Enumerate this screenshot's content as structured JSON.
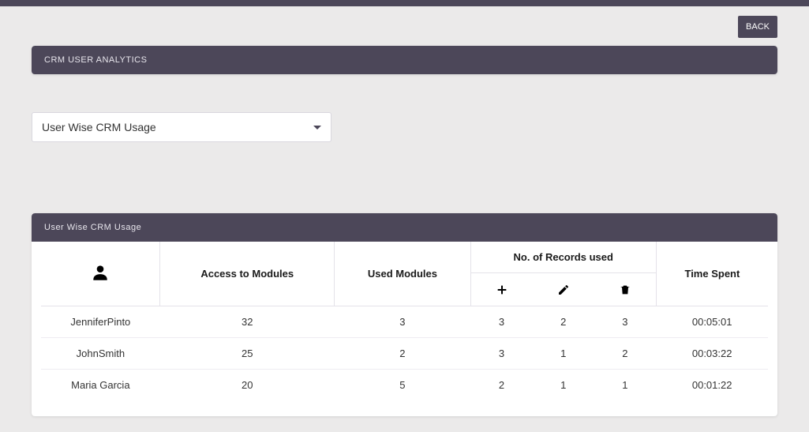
{
  "buttons": {
    "back": "BACK"
  },
  "header": {
    "title": "CRM USER ANALYTICS"
  },
  "dropdown": {
    "selected": "User Wise CRM Usage"
  },
  "table_panel": {
    "title": "User Wise CRM Usage"
  },
  "columns": {
    "access": "Access to Modules",
    "used": "Used Modules",
    "records_group": "No. of Records used",
    "time": "Time Spent"
  },
  "record_icons": {
    "add": "plus-icon",
    "edit": "pencil-icon",
    "delete": "trash-icon"
  },
  "rows": [
    {
      "name": "JenniferPinto",
      "access": "32",
      "used": "3",
      "added": "3",
      "edited": "2",
      "deleted": "3",
      "time": "00:05:01"
    },
    {
      "name": "JohnSmith",
      "access": "25",
      "used": "2",
      "added": "3",
      "edited": "1",
      "deleted": "2",
      "time": "00:03:22"
    },
    {
      "name": "Maria Garcia",
      "access": "20",
      "used": "5",
      "added": "2",
      "edited": "1",
      "deleted": "1",
      "time": "00:01:22"
    }
  ]
}
